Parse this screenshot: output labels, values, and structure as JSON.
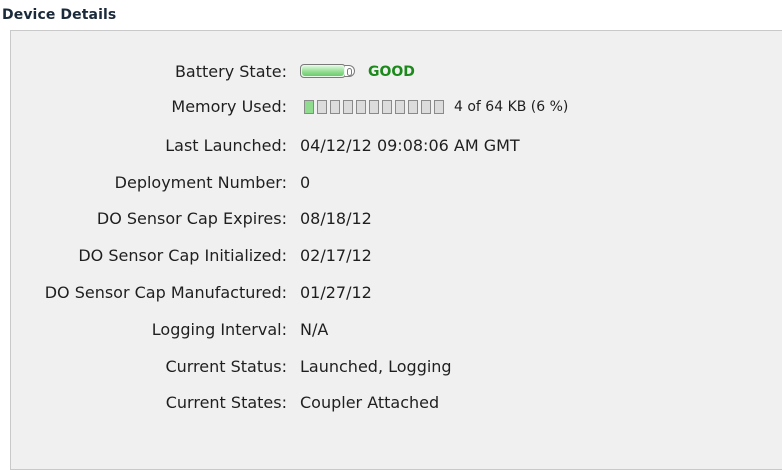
{
  "section": {
    "title": "Device Details"
  },
  "battery": {
    "label": "Battery State:",
    "status": "GOOD",
    "level": 1.0,
    "status_color": "#1b8a1b"
  },
  "memory": {
    "label": "Memory Used:",
    "summary": "4 of 64 KB (6 %)",
    "used_fraction": 0.06,
    "segments": 11
  },
  "details": [
    {
      "label": "Last Launched:",
      "value": "04/12/12 09:08:06 AM GMT"
    },
    {
      "label": "Deployment Number:",
      "value": "0"
    },
    {
      "label": "DO Sensor Cap Expires:",
      "value": "08/18/12"
    },
    {
      "label": "DO Sensor Cap Initialized:",
      "value": "02/17/12"
    },
    {
      "label": "DO Sensor Cap Manufactured:",
      "value": "01/27/12"
    },
    {
      "label": "Logging Interval:",
      "value": "N/A"
    },
    {
      "label": "Current Status:",
      "value": "Launched, Logging"
    },
    {
      "label": "Current States:",
      "value": "Coupler Attached"
    }
  ]
}
